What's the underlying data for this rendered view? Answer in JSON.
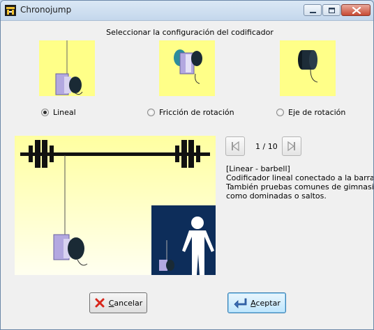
{
  "window": {
    "title": "Chronojump",
    "minimize_label": "Minimize",
    "maximize_label": "Maximize",
    "close_label": "Close"
  },
  "heading": "Seleccionar la configuración del codificador",
  "options": [
    {
      "label": "Lineal",
      "selected": true,
      "icon": "linear-encoder-icon"
    },
    {
      "label": "Fricción de rotación",
      "selected": false,
      "icon": "rotary-friction-encoder-icon"
    },
    {
      "label": "Eje de rotación",
      "selected": false,
      "icon": "rotary-axis-encoder-icon"
    }
  ],
  "navigation": {
    "counter": "1 / 10",
    "prev_icon": "skip-back-icon",
    "next_icon": "skip-forward-icon"
  },
  "description": {
    "lines": [
      "[Linear - barbell]",
      "Codificador lineal conectado a la barra.",
      "También pruebas comunes de gimnasio",
      "como dominadas o saltos."
    ]
  },
  "buttons": {
    "cancel_first": "C",
    "cancel_rest": "ancelar",
    "accept_first": "A",
    "accept_rest": "ceptar"
  },
  "colors": {
    "thumb_bg": "#ffff88",
    "person_panel": "#0d2d5a",
    "close_button": "#c74a34",
    "accent_border": "#3c7fb1"
  }
}
